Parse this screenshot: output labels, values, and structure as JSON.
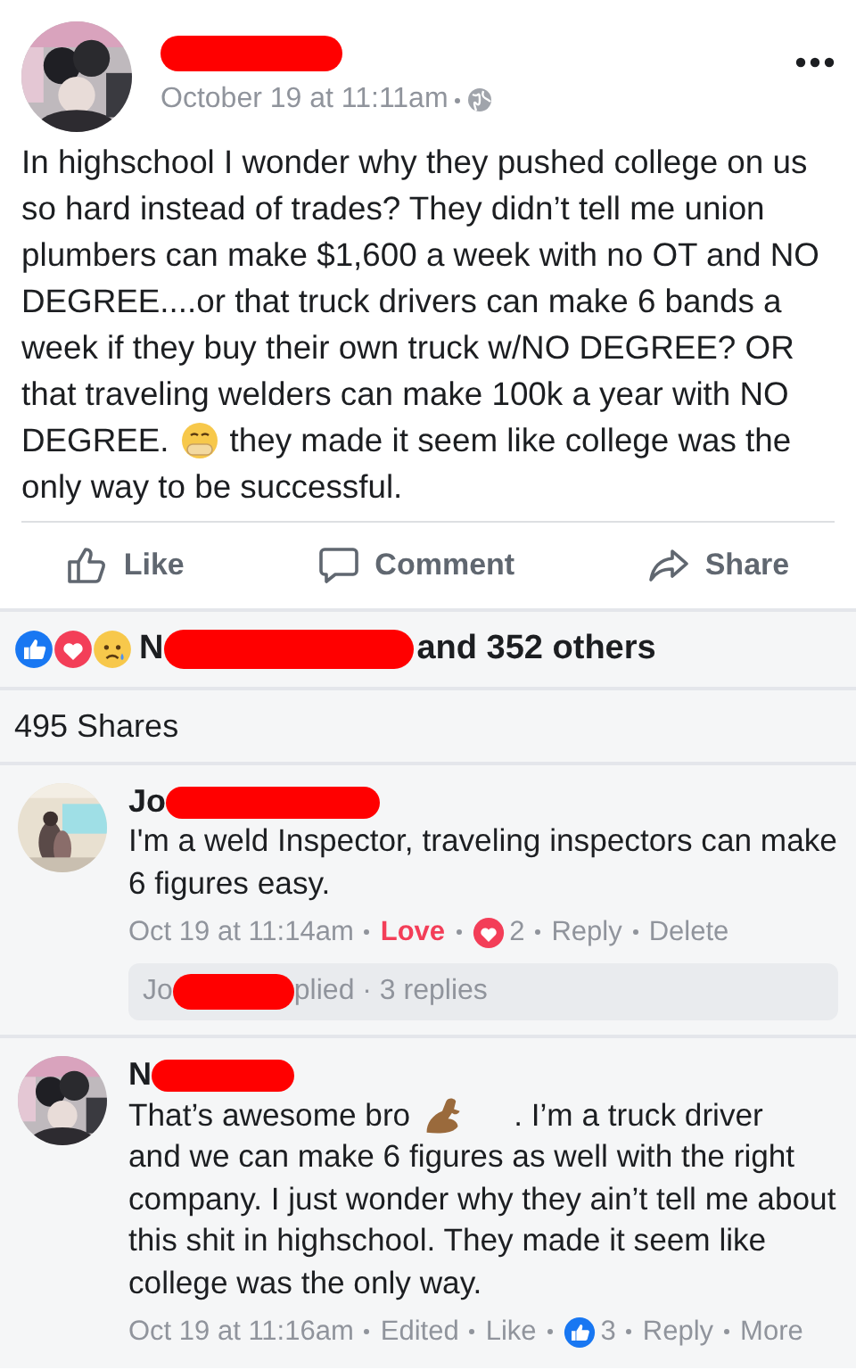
{
  "post": {
    "author": {
      "redacted": true
    },
    "time": "October 19 at 11:11am",
    "body": [
      {
        "parts": [
          {
            "kind": "text",
            "text": "In highschool I wonder why they pushed college on us so hard instead of trades? They didn’t tell me union plumbers can make $1,600 a week with no OT and NO DEGREE....or that truck drivers can make 6 bands a week if they buy their own truck w/NO DEGREE? OR that traveling welders can make 100k a year with NO"
          }
        ]
      },
      {
        "parts": [
          {
            "kind": "text",
            "text": "DEGREE."
          },
          {
            "kind": "smiley"
          },
          {
            "kind": "text",
            "text": "they made it seem like college was the"
          }
        ]
      },
      {
        "parts": [
          {
            "kind": "text",
            "text": "only way to be successful."
          }
        ]
      }
    ],
    "actions": [
      {
        "kind": "like",
        "label": "Like"
      },
      {
        "kind": "comment",
        "label": "Comment"
      },
      {
        "kind": "share",
        "label": "Share"
      }
    ]
  },
  "reactions_summary": {
    "reactions": [
      {
        "kind": "like"
      },
      {
        "kind": "love"
      },
      {
        "kind": "sad"
      }
    ],
    "visible": "N",
    "redacted": true,
    "rest": "and 352 others"
  },
  "shares": "495 Shares",
  "comments": [
    {
      "author": {
        "visible": "Jo",
        "redacted": true
      },
      "body": [
        {
          "parts": [
            {
              "kind": "text",
              "text": "I'm a weld Inspector, traveling inspectors can make 6 figures easy."
            }
          ]
        }
      ],
      "meta": [
        {
          "kind": "time",
          "text": "Oct 19 at 11:14am"
        },
        {
          "kind": "link",
          "text": "Love",
          "active": true
        },
        {
          "kind": "love",
          "count": "2"
        },
        {
          "kind": "link",
          "text": "Reply",
          "active": false
        },
        {
          "kind": "link",
          "text": "Delete",
          "active": false
        }
      ],
      "replies": {
        "visible": "Jo",
        "redacted": true,
        "rest": "plied · 3 replies"
      }
    },
    {
      "author": {
        "visible": "N",
        "redacted": true
      },
      "body": [
        {
          "parts": [
            {
              "kind": "text",
              "text": "That’s awesome bro"
            },
            {
              "kind": "muscle"
            },
            {
              "kind": "text",
              "text": ". I’m a truck driver"
            }
          ]
        },
        {
          "parts": [
            {
              "kind": "text",
              "text": "and we can make 6 figures as well with the right company. I just wonder why they ain’t tell me about this shit in highschool. They made it seem like college was the only way."
            }
          ]
        }
      ],
      "meta": [
        {
          "kind": "time",
          "text": "Oct 19 at 11:16am"
        },
        {
          "kind": "text",
          "text": "Edited"
        },
        {
          "kind": "link",
          "text": "Like",
          "active": false
        },
        {
          "kind": "like",
          "count": "3"
        },
        {
          "kind": "link",
          "text": "Reply",
          "active": false
        },
        {
          "kind": "link",
          "text": "More",
          "active": false
        }
      ]
    }
  ]
}
